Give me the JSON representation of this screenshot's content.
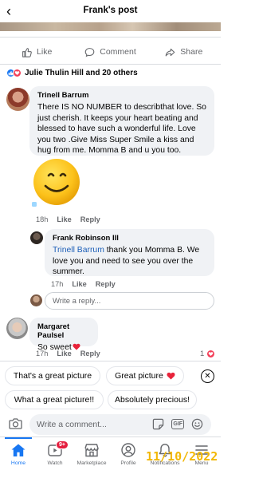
{
  "header": {
    "back": "‹",
    "title": "Frank's post"
  },
  "actions": {
    "like": "Like",
    "comment": "Comment",
    "share": "Share"
  },
  "reactions": {
    "summary": "Julie Thulin Hill and 20 others"
  },
  "comments": [
    {
      "name": "Trinell Barrum",
      "text": "There IS NO NUMBER to describthat love. So just cherish. It keeps your heart beating and blessed to have such a wonderful life. Love you two .Give Miss Super Smile a kiss and hug from me.  Momma B and u you too.",
      "time": "18h",
      "like": "Like",
      "reply": "Reply"
    },
    {
      "name": "Frank Robinson III",
      "mention": "Trinell Barrum",
      "text": " thank you Momma B.  We love you and need to see you over the summer.",
      "time": "17h",
      "like": "Like",
      "reply": "Reply"
    },
    {
      "name": "Margaret Paulsel",
      "text": "So sweet",
      "time": "17h",
      "like": "Like",
      "reply": "Reply",
      "reaction_count": "1"
    }
  ],
  "reply_input": {
    "placeholder": "Write a reply..."
  },
  "suggestions": [
    "That's a great picture",
    "Great picture",
    "What a great picture!!",
    "Absolutely precious!"
  ],
  "comment_input": {
    "placeholder": "Write a comment...",
    "gif": "GIF"
  },
  "tabs": [
    {
      "label": "Home"
    },
    {
      "label": "Watch",
      "badge": "9+"
    },
    {
      "label": "Marketplace"
    },
    {
      "label": "Profile"
    },
    {
      "label": "Notifications"
    },
    {
      "label": "Menu"
    }
  ],
  "datestamp": "11/10/2022",
  "colors": {
    "accent": "#1877f2",
    "love": "#f33e58",
    "datestamp": "#f2b705"
  }
}
